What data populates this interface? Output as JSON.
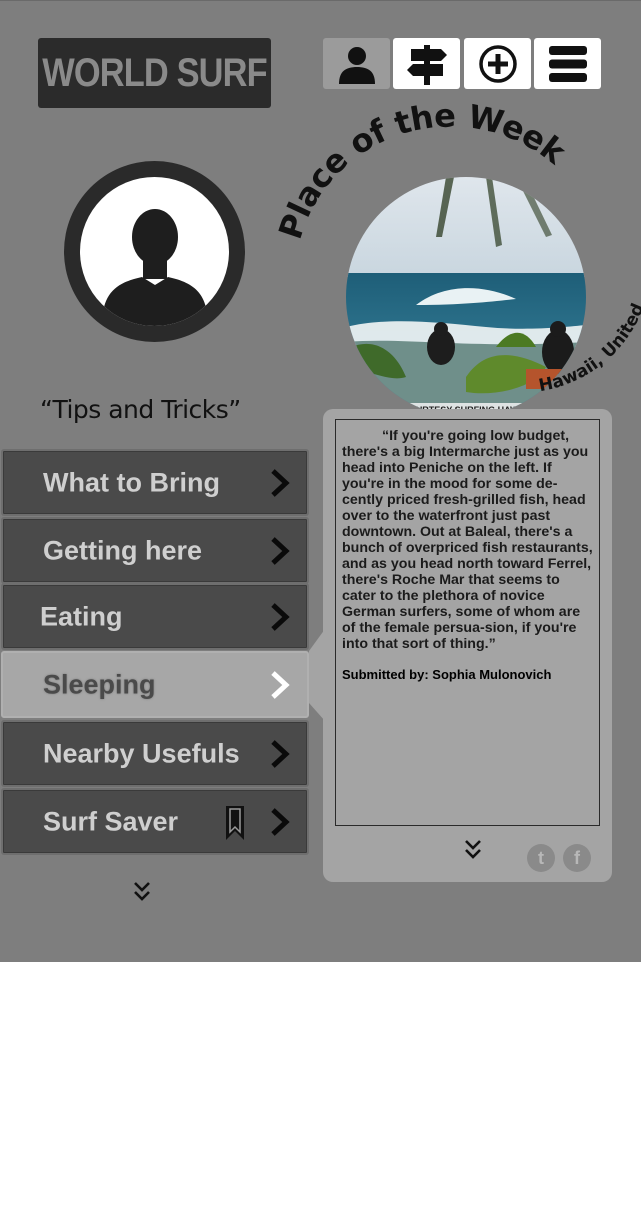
{
  "app": {
    "logo_text": "WORLD SURF"
  },
  "nav": {
    "items": [
      {
        "icon": "person-icon",
        "active": true
      },
      {
        "icon": "signpost-icon",
        "active": false
      },
      {
        "icon": "add-circle-icon",
        "active": false
      },
      {
        "icon": "menu-icon",
        "active": false
      }
    ]
  },
  "profile": {
    "avatar_icon": "user-silhouette-icon"
  },
  "tips": {
    "title": "“Tips and Tricks”"
  },
  "place_of_week": {
    "heading": "Place of the Week",
    "location": "Hawaii, United States",
    "photo_credit": "COURTESY SURFING HAWAII"
  },
  "menu": {
    "items": [
      {
        "label": "What to Bring",
        "active": false
      },
      {
        "label": "Getting here",
        "active": false
      },
      {
        "label": "Eating",
        "active": false
      },
      {
        "label": "Sleeping",
        "active": true
      },
      {
        "label": "Nearby Usefuls",
        "active": false
      },
      {
        "label": "Surf Saver",
        "active": false,
        "icon": "bookmark-icon"
      }
    ],
    "more_icon": "double-chevron-down-icon"
  },
  "content": {
    "quote": "“If you're going low budget, there's a big Intermarche just as you head into Peniche on the left. If you're in the mood for some de-cently priced fresh-grilled fish, head over to the waterfront just past downtown. Out at Baleal, there's a bunch of overpriced fish restaurants, and as you head north toward Ferrel, there's Roche Mar that seems to cater to the plethora of novice German surfers, some of whom are of the female persua-sion, if you're into that sort of thing.”",
    "submitted_by": "Submitted by: Sophia Mulonovich",
    "twitter_letter": "t",
    "facebook_letter": "f"
  },
  "colors": {
    "background": "#7e7e7e",
    "menu_item": "#4a4a4a",
    "menu_active": "#a7a7a7",
    "panel": "#a4a4a4"
  }
}
